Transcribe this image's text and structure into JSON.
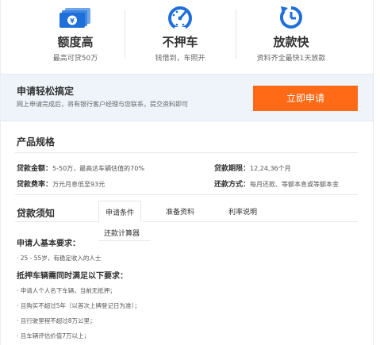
{
  "colors": {
    "accent_orange": "#ff6a16",
    "icon_blue": "#1e6fd9",
    "band_bg": "#eef4fa"
  },
  "features": [
    {
      "icon": "banknote-stack-icon",
      "title": "额度高",
      "subtitle": "最高可贷50万"
    },
    {
      "icon": "speedometer-icon",
      "title": "不押车",
      "subtitle": "钱借到，车照开"
    },
    {
      "icon": "clock-arrow-icon",
      "title": "放款快",
      "subtitle": "资料齐全最快1天放款"
    }
  ],
  "apply": {
    "title": "申请轻松搞定",
    "description": "网上申请完成后，将有银行客户经理与您联系，提交资料即可",
    "button_label": "立即申请"
  },
  "product": {
    "heading": "产品规格",
    "specs": [
      {
        "label": "贷款金额：",
        "value": "5-50万，最高达车辆估值的70%"
      },
      {
        "label": "贷款期限：",
        "value": "12,24,36个月"
      },
      {
        "label": "贷款费率：",
        "value": "万元月息低至93元"
      },
      {
        "label": "还款方式：",
        "value": "每月还款、等额本息或等额本金"
      }
    ]
  },
  "notes": {
    "heading": "贷款须知",
    "tabs": [
      "申请条件",
      "准备资料",
      "利率说明",
      "还款计算器"
    ],
    "active_tab": "申请条件",
    "sections": [
      {
        "title": "申请人基本要求：",
        "items": [
          "· 25 - 55岁，有稳定收入的人士"
        ]
      },
      {
        "title": "抵押车辆需同时满足以下要求：",
        "items": [
          "· 申请人个人名下车辆，当前无抵押；",
          "· 且购买不超过5年（以首次上牌登记日为准）；",
          "· 且行驶里程不超过8万公里；",
          "· 且车辆评估价值7万以上；"
        ]
      }
    ]
  }
}
